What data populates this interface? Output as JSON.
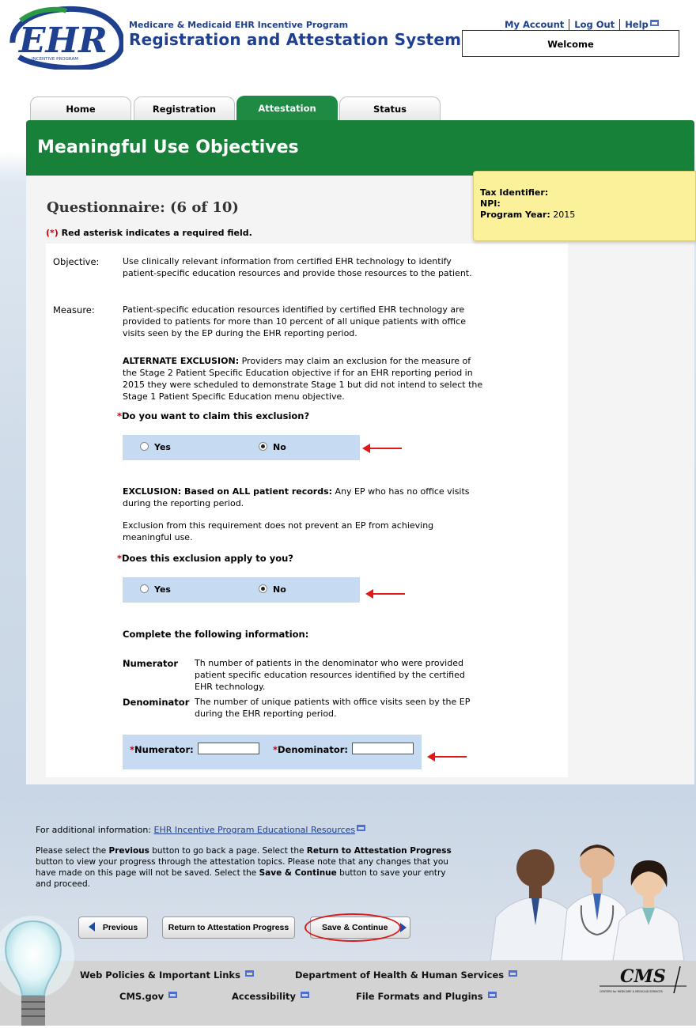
{
  "header": {
    "logo_text": "EHR",
    "logo_sub": "INCENTIVE PROGRAM",
    "program_subtitle": "Medicare & Medicaid EHR Incentive Program",
    "program_title": "Registration and Attestation System",
    "links": {
      "my_account": "My Account",
      "log_out": "Log Out",
      "help": "Help"
    },
    "welcome": "Welcome",
    "icons": {
      "external": "external-link-icon"
    }
  },
  "tabs": [
    {
      "label": "Home"
    },
    {
      "label": "Registration"
    },
    {
      "label": "Attestation",
      "active": true
    },
    {
      "label": "Status"
    }
  ],
  "banner": {
    "title": "Meaningful Use Objectives"
  },
  "info_box": {
    "tax_label": "Tax Identifier:",
    "npi_label": "NPI:",
    "year_label": "Program Year:",
    "year_value": "2015"
  },
  "questionnaire": {
    "title": "Questionnaire: (6 of 10)",
    "required_prefix": "(*)",
    "required_text": " Red asterisk indicates a required field.",
    "objective_label": "Objective:",
    "objective_text": "Use clinically relevant information from certified EHR technology to identify patient-specific education resources and provide those resources to the patient.",
    "measure_label": "Measure:",
    "measure_text": "Patient-specific education resources identified by certified EHR technology are provided to patients for more than 10 percent of all unique patients with office visits seen by the EP during the EHR reporting period.",
    "alt_exclusion_label": "ALTERNATE EXCLUSION:",
    "alt_exclusion_text": " Providers may claim an exclusion for the measure of the Stage 2 Patient Specific Education objective if for an EHR reporting period in 2015 they were scheduled to demonstrate Stage 1 but did not intend to select the Stage 1 Patient Specific Education menu objective.",
    "q1": "Do you want to claim this exclusion?",
    "q1_yes": "Yes",
    "q1_no": "No",
    "q1_selected": "No",
    "exclusion_label": "EXCLUSION: Based on ALL patient records:",
    "exclusion_text": " Any EP who has no office visits during the reporting period.",
    "exclusion_note": "Exclusion from this requirement does not prevent an EP from achieving meaningful use.",
    "q2": "Does this exclusion apply to you?",
    "q2_yes": "Yes",
    "q2_no": "No",
    "q2_selected": "No",
    "complete_label": "Complete the following information:",
    "numerator_label": "Numerator",
    "numerator_text": "Th number of patients in the denominator who were provided patient specific education resources identified by the certified EHR technology.",
    "denominator_label": "Denominator",
    "denominator_text": "The number of unique patients with office visits seen by the EP during the EHR reporting period.",
    "numerator_field": "Numerator:",
    "denominator_field": "Denominator:",
    "numerator_value": "",
    "denominator_value": "",
    "asterisk": "*"
  },
  "additional": {
    "prefix": "For additional information: ",
    "link": "EHR Incentive Program Educational Resources"
  },
  "instructions": {
    "p1": "Please select the ",
    "b1": "Previous",
    "p2": " button to go back a page. Select the ",
    "b2": "Return to Attestation Progress",
    "p3": " button to view your progress through the attestation topics. Please note that any changes that you have made on this page will not be saved. Select the ",
    "b3": "Save & Continue",
    "p4": " button to save your entry and proceed."
  },
  "buttons": {
    "previous": "Previous",
    "return": "Return to Attestation Progress",
    "save": "Save & Continue"
  },
  "footer": {
    "web_policies": "Web Policies & Important Links",
    "hhs": "Department of Health & Human Services",
    "cms_gov": "CMS.gov",
    "accessibility": "Accessibility",
    "file_formats": "File Formats and Plugins",
    "cms_logo": "CMS",
    "cms_logo_sub": "CENTERS for MEDICARE & MEDICAID SERVICES"
  },
  "colors": {
    "brand_green": "#17813a",
    "brand_blue": "#1f3f8f",
    "required_red": "#d40000",
    "highlight_band": "#c6dbf1",
    "info_yellow": "#fbf19b"
  }
}
